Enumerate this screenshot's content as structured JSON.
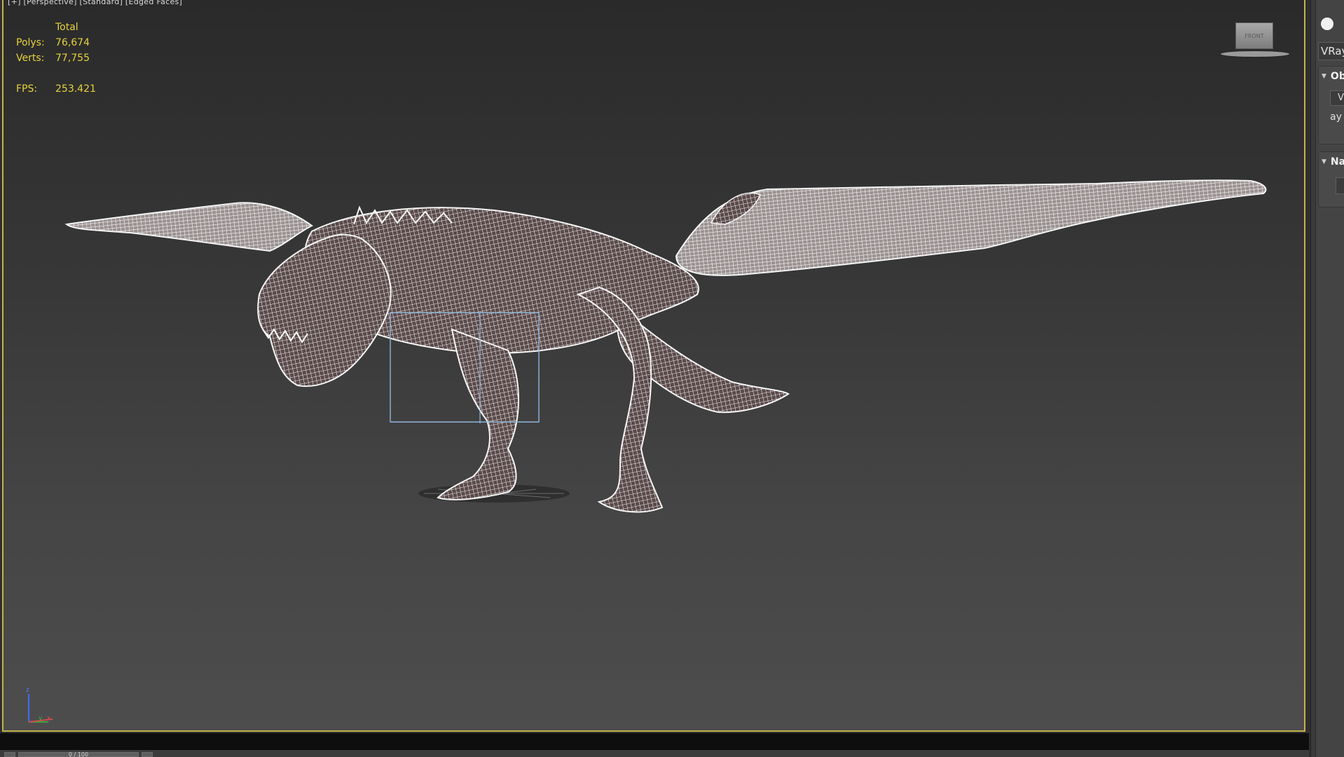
{
  "viewport": {
    "label": "[+] [Perspective] [Standard] [Edged Faces]",
    "stats": {
      "header": "Total",
      "polys_label": "Polys:",
      "polys_value": "76,674",
      "verts_label": "Verts:",
      "verts_value": "77,755",
      "fps_label": "FPS:",
      "fps_value": "253.421"
    },
    "viewcube": {
      "face_label": "FRONT"
    },
    "axis": {
      "z": "z",
      "y": "y",
      "x": "x"
    }
  },
  "timeslider": {
    "position_label": "0 / 100",
    "prev_icon": "chevron-left-icon",
    "next_icon": "chevron-right-icon"
  },
  "command_panel": {
    "renderer_dropdown": "VRay",
    "rollouts": [
      {
        "title": "Ob",
        "button_label": "V",
        "text": "ay"
      },
      {
        "title": "Na"
      }
    ]
  },
  "colors": {
    "stats_text": "#e6d23c",
    "viewport_border": "#c3b34a",
    "wireframe": "#f2eeee",
    "bounding_box": "#8fb7dc"
  }
}
